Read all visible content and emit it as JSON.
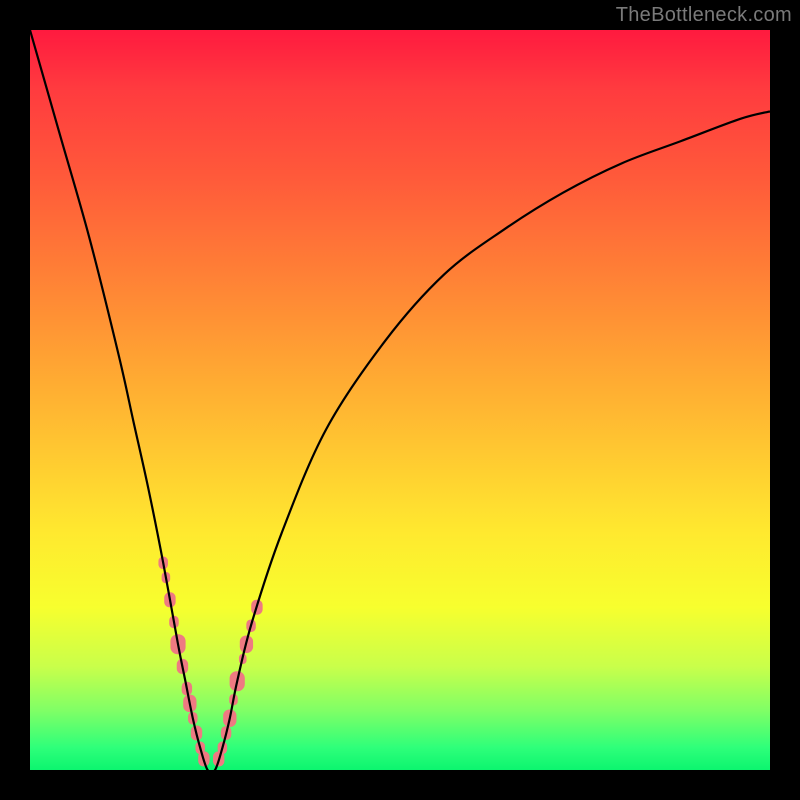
{
  "watermark": "TheBottleneck.com",
  "chart_data": {
    "type": "line",
    "title": "",
    "xlabel": "",
    "ylabel": "",
    "xlim": [
      0,
      100
    ],
    "ylim": [
      0,
      100
    ],
    "grid": false,
    "series": [
      {
        "name": "main-curve",
        "color": "#000000",
        "x": [
          0,
          4,
          8,
          12,
          14,
          16,
          18,
          20,
          21,
          22,
          23,
          24,
          25,
          26,
          27,
          28,
          30,
          34,
          40,
          48,
          56,
          64,
          72,
          80,
          88,
          96,
          100
        ],
        "y": [
          100,
          86,
          72,
          56,
          47,
          38,
          28,
          17,
          12,
          7,
          3,
          0,
          0,
          3,
          7,
          12,
          20,
          32,
          46,
          58,
          67,
          73,
          78,
          82,
          85,
          88,
          89
        ]
      }
    ],
    "trough_x": 24.5,
    "markers": {
      "color": "#ee7a82",
      "left_branch_y_range": [
        2,
        30
      ],
      "right_branch_y_range": [
        2,
        23
      ],
      "points": [
        {
          "branch": "left",
          "y": 28,
          "size": 10
        },
        {
          "branch": "left",
          "y": 26,
          "size": 9
        },
        {
          "branch": "left",
          "y": 23,
          "size": 12
        },
        {
          "branch": "left",
          "y": 20,
          "size": 10
        },
        {
          "branch": "left",
          "y": 17,
          "size": 16
        },
        {
          "branch": "left",
          "y": 14,
          "size": 12
        },
        {
          "branch": "left",
          "y": 11,
          "size": 11
        },
        {
          "branch": "left",
          "y": 9,
          "size": 14
        },
        {
          "branch": "left",
          "y": 7,
          "size": 10
        },
        {
          "branch": "left",
          "y": 5,
          "size": 12
        },
        {
          "branch": "left",
          "y": 3,
          "size": 10
        },
        {
          "branch": "left",
          "y": 1.5,
          "size": 12
        },
        {
          "branch": "right",
          "y": 1.5,
          "size": 12
        },
        {
          "branch": "right",
          "y": 3,
          "size": 10
        },
        {
          "branch": "right",
          "y": 5,
          "size": 11
        },
        {
          "branch": "right",
          "y": 7,
          "size": 14
        },
        {
          "branch": "right",
          "y": 9.5,
          "size": 9
        },
        {
          "branch": "right",
          "y": 12,
          "size": 16
        },
        {
          "branch": "right",
          "y": 15,
          "size": 8
        },
        {
          "branch": "right",
          "y": 17,
          "size": 14
        },
        {
          "branch": "right",
          "y": 19.5,
          "size": 10
        },
        {
          "branch": "right",
          "y": 22,
          "size": 12
        }
      ]
    }
  }
}
